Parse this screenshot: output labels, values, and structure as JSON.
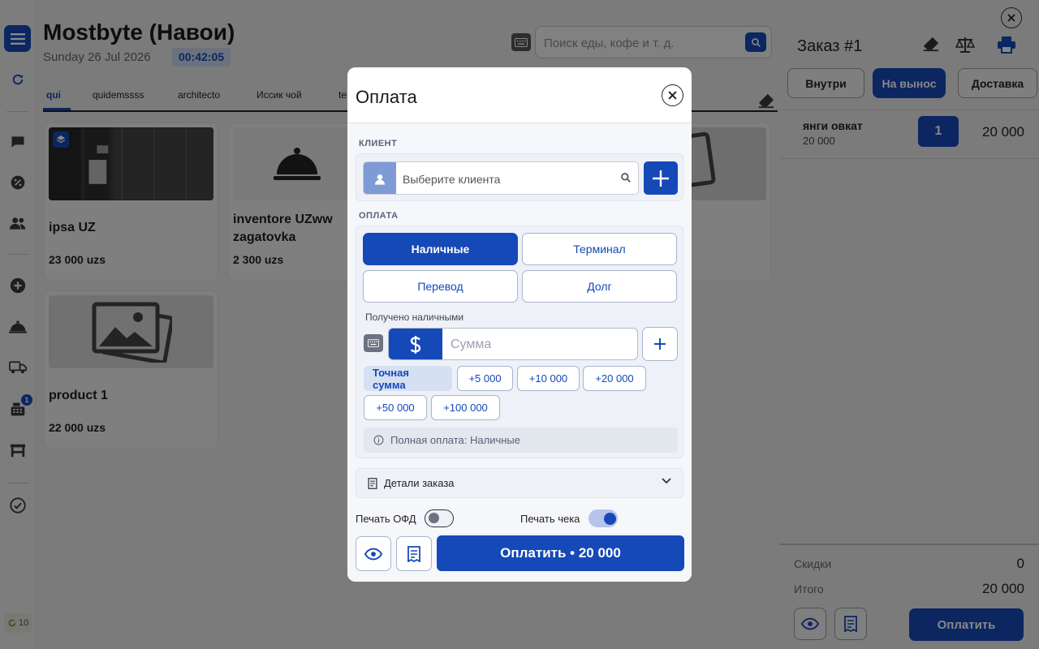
{
  "header": {
    "title": "Mostbyte (Навои)",
    "date": "Sunday 26 Jul 2026",
    "clock": "00:42:05",
    "search_placeholder": "Поиск еды, кофе и т. д."
  },
  "tabs": [
    "qui",
    "quidemssss",
    "architecto",
    "Иссик чой",
    "te"
  ],
  "products": [
    {
      "name": "ipsa UZ",
      "price": "23 000 uzs"
    },
    {
      "name": "inventore UZww zagatovka",
      "price": "2 300 uzs"
    },
    {
      "name": "product 1",
      "price": "22 000 uzs"
    }
  ],
  "sidebar": {
    "badge": "1",
    "version": "10"
  },
  "order": {
    "title": "Заказ #1",
    "types": [
      "Внутри",
      "На вынос",
      "Доставка"
    ],
    "active_type": "На вынос",
    "item": {
      "name": "янги овкат",
      "unit_price": "20 000",
      "qty": "1",
      "total": "20 000"
    },
    "discount_label": "Скидки",
    "discount": "0",
    "total_label": "Итого",
    "total": "20 000",
    "pay_label": "Оплатить"
  },
  "modal": {
    "title": "Оплата",
    "client_label": "КЛИЕНТ",
    "client_placeholder": "Выберите клиента",
    "payment_label": "ОПЛАТА",
    "methods": [
      "Наличные",
      "Терминал",
      "Перевод",
      "Долг"
    ],
    "active_method": "Наличные",
    "received_label": "Получено наличными",
    "currency_symbol": "$",
    "amount_placeholder": "Сумма",
    "exact_label": "Точная сумма",
    "quick_amounts": [
      "+5 000",
      "+10 000",
      "+20 000",
      "+50 000",
      "+100 000"
    ],
    "info_text": "Полная оплата: Наличные",
    "details_label": "Детали заказа",
    "print_ofd_label": "Печать ОФД",
    "print_ofd_on": false,
    "print_receipt_label": "Печать чека",
    "print_receipt_on": true,
    "pay_button": "Оплатить • 20 000"
  },
  "colors": {
    "accent": "#1549b8",
    "overlay": "rgba(0,0,0,0.47)"
  }
}
